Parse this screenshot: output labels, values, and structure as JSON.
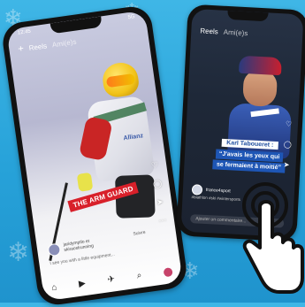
{
  "left_phone": {
    "status_time": "12:45",
    "status_right": "5G",
    "tab_reels": "Reels",
    "tab_amis": "Ami(e)s",
    "overlay_text": "THE ARM GUARD",
    "bib_text": "Allianz",
    "user_line1": "jaridymptlo et",
    "user_line2": "skiracelrunning",
    "follow_label": "Suivre",
    "caption": "I see you with a little equipment...",
    "icons": [
      "plus-icon",
      "heart-icon",
      "comment-icon",
      "share-icon",
      "more-icon",
      "home-icon",
      "reels-icon",
      "send-icon",
      "search-icon"
    ]
  },
  "right_phone": {
    "status_time": "12:45",
    "tab_reels": "Reels",
    "tab_amis": "Ami(e)s",
    "quote_name": "Karl Taboueret :",
    "quote_line1": "“J'avais les yeux qui",
    "quote_line2": "se fermaient à moitié”",
    "username": "france4sport",
    "tags": "#biathlon #ski #wintersports",
    "comment_placeholder": "Ajouter un commentaire..."
  },
  "colors": {
    "background": "#2aa4db",
    "arm_guard_red": "#d8202a",
    "quote_blue": "#1e56b5"
  }
}
